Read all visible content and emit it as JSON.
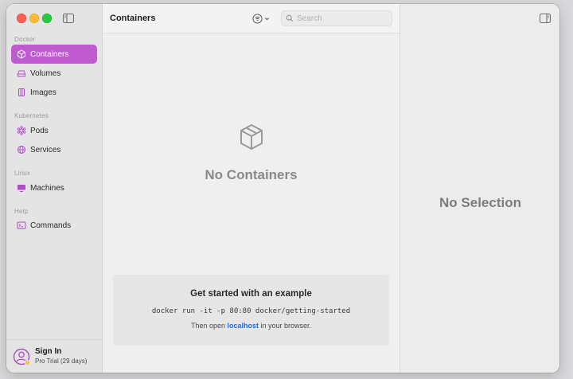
{
  "sidebar": {
    "sections": [
      {
        "label": "Docker",
        "items": [
          {
            "label": "Containers",
            "icon": "cube-icon",
            "active": true
          },
          {
            "label": "Volumes",
            "icon": "drive-icon"
          },
          {
            "label": "Images",
            "icon": "images-icon"
          }
        ]
      },
      {
        "label": "Kubernetes",
        "items": [
          {
            "label": "Pods",
            "icon": "pods-icon"
          },
          {
            "label": "Services",
            "icon": "services-icon"
          }
        ]
      },
      {
        "label": "Linux",
        "items": [
          {
            "label": "Machines",
            "icon": "display-icon"
          }
        ]
      },
      {
        "label": "Help",
        "items": [
          {
            "label": "Commands",
            "icon": "terminal-icon"
          }
        ]
      }
    ],
    "footer": {
      "name": "Sign In",
      "subtitle": "Pro Trial (29 days)"
    }
  },
  "main": {
    "title": "Containers",
    "search": {
      "placeholder": "Search",
      "value": ""
    },
    "empty_state": {
      "title": "No Containers"
    },
    "example": {
      "title": "Get started with an example",
      "command": "docker run -it -p 80:80 docker/getting-started",
      "hint_prefix": "Then open ",
      "hint_link": "localhost",
      "hint_suffix": " in your browser."
    }
  },
  "detail": {
    "empty_text": "No Selection"
  },
  "colors": {
    "accent": "#c05ad0",
    "link": "#1f6fe0",
    "icon": "#b04cc4"
  }
}
